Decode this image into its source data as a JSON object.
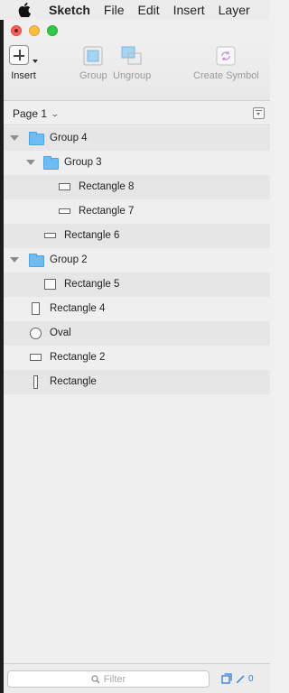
{
  "menubar": {
    "app_name": "Sketch",
    "items": [
      "File",
      "Edit",
      "Insert",
      "Layer"
    ]
  },
  "toolbar": {
    "insert_label": "Insert",
    "group_label": "Group",
    "ungroup_label": "Ungroup",
    "create_symbol_label": "Create Symbol"
  },
  "page": {
    "selected": "Page 1"
  },
  "layers": [
    {
      "name": "Group 4",
      "type": "group",
      "expanded": true
    },
    {
      "name": "Group 3",
      "type": "group",
      "expanded": true
    },
    {
      "name": "Rectangle 8",
      "type": "rectangle"
    },
    {
      "name": "Rectangle 7",
      "type": "rectangle"
    },
    {
      "name": "Rectangle 6",
      "type": "rectangle"
    },
    {
      "name": "Group 2",
      "type": "group",
      "expanded": true
    },
    {
      "name": "Rectangle 5",
      "type": "rectangle"
    },
    {
      "name": "Rectangle 4",
      "type": "rectangle"
    },
    {
      "name": "Oval",
      "type": "oval"
    },
    {
      "name": "Rectangle 2",
      "type": "rectangle"
    },
    {
      "name": "Rectangle",
      "type": "rectangle"
    }
  ],
  "filter": {
    "placeholder": "Filter"
  },
  "bottom": {
    "count": "0"
  },
  "colors": {
    "accent": "#2b7fd6",
    "folder": "#6ebcf2"
  }
}
